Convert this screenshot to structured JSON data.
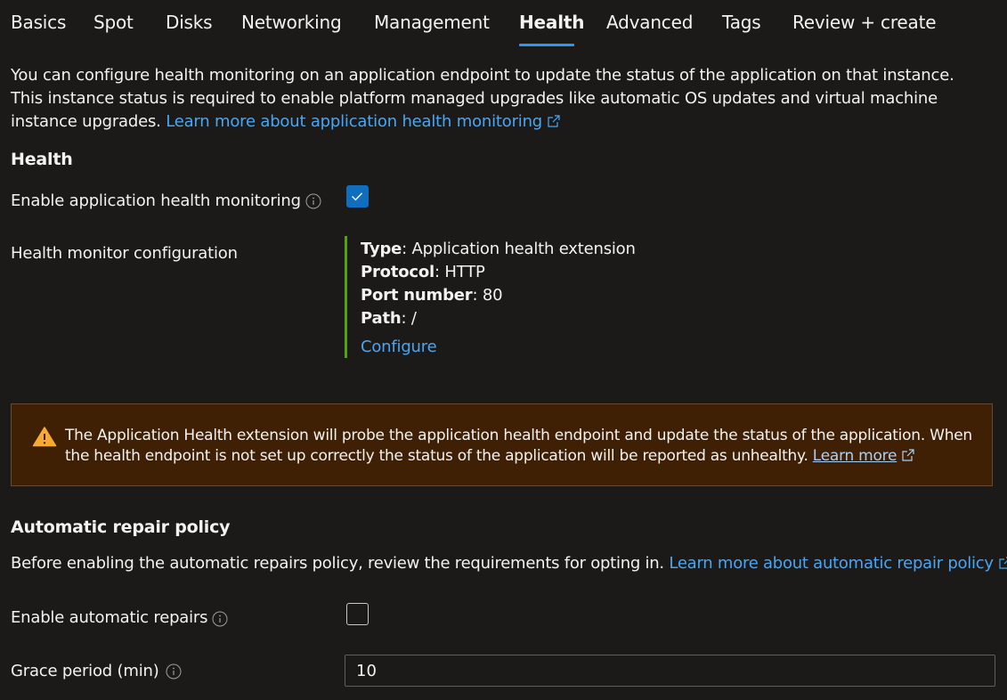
{
  "tabs": [
    {
      "label": "Basics"
    },
    {
      "label": "Spot"
    },
    {
      "label": "Disks"
    },
    {
      "label": "Networking"
    },
    {
      "label": "Management"
    },
    {
      "label": "Health"
    },
    {
      "label": "Advanced"
    },
    {
      "label": "Tags"
    },
    {
      "label": "Review + create"
    }
  ],
  "active_tab": "Health",
  "accent_color": "#2899f5",
  "intro": {
    "text": "You can configure health monitoring on an application endpoint to update the status of the application on that instance. This instance status is required to enable platform managed upgrades like automatic OS updates and virtual machine instance upgrades.",
    "link": "Learn more about application health monitoring"
  },
  "health": {
    "title": "Health",
    "enable_label": "Enable application health monitoring",
    "enable_checked": true,
    "config_label": "Health monitor configuration",
    "config": {
      "type_key": "Type",
      "type_value": ": Application health extension",
      "protocol_key": "Protocol",
      "protocol_value": ": HTTP",
      "port_key": "Port number",
      "port_value": ": 80",
      "path_key": "Path",
      "path_value": ": /",
      "configure_link": "Configure"
    }
  },
  "warning": {
    "text": "The Application Health extension will probe the application health endpoint and update the status of the application. When the health endpoint is not set up correctly the status of the application will be reported as unhealthy.",
    "link": "Learn more",
    "color": "#3f2004"
  },
  "repair": {
    "title": "Automatic repair policy",
    "description": "Before enabling the automatic repairs policy, review the requirements for opting in.",
    "link": "Learn more about automatic repair policy",
    "enable_label": "Enable automatic repairs",
    "enable_checked": false,
    "grace_label": "Grace period (min)",
    "grace_value": "10"
  }
}
